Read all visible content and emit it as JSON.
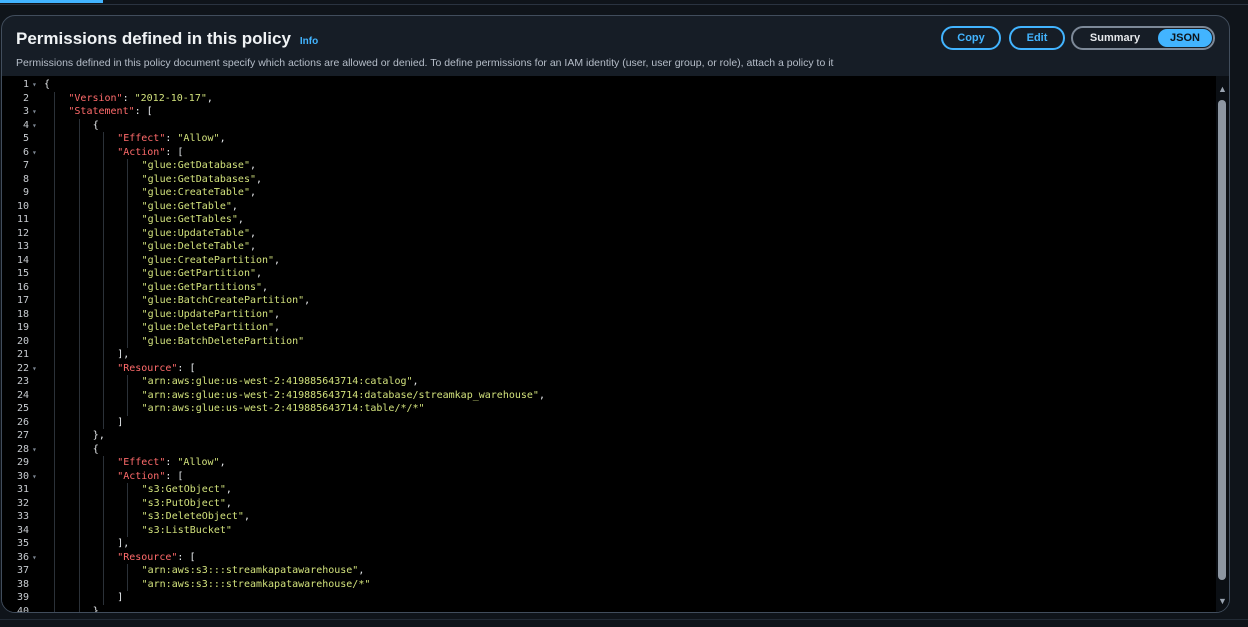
{
  "panel": {
    "title": "Permissions defined in this policy",
    "info_label": "Info",
    "description": "Permissions defined in this policy document specify which actions are allowed or denied. To define permissions for an IAM identity (user, user group, or role), attach a policy to it",
    "copy_label": "Copy",
    "edit_label": "Edit",
    "view_toggle": {
      "summary_label": "Summary",
      "json_label": "JSON",
      "selected": "JSON"
    }
  },
  "colors": {
    "accent": "#42b4ff",
    "json_key": "#ff6b6b",
    "json_string": "#d2e27c"
  },
  "editor": {
    "lines": [
      {
        "n": "1",
        "fold": true,
        "indent": 0,
        "tokens": [
          [
            "p",
            "{"
          ]
        ]
      },
      {
        "n": "2",
        "fold": false,
        "indent": 1,
        "tokens": [
          [
            "k",
            "\"Version\""
          ],
          [
            "p",
            ": "
          ],
          [
            "s",
            "\"2012-10-17\""
          ],
          [
            "p",
            ","
          ]
        ]
      },
      {
        "n": "3",
        "fold": true,
        "indent": 1,
        "tokens": [
          [
            "k",
            "\"Statement\""
          ],
          [
            "p",
            ": ["
          ]
        ]
      },
      {
        "n": "4",
        "fold": true,
        "indent": 2,
        "tokens": [
          [
            "p",
            "{"
          ]
        ]
      },
      {
        "n": "5",
        "fold": false,
        "indent": 3,
        "tokens": [
          [
            "k",
            "\"Effect\""
          ],
          [
            "p",
            ": "
          ],
          [
            "s",
            "\"Allow\""
          ],
          [
            "p",
            ","
          ]
        ]
      },
      {
        "n": "6",
        "fold": true,
        "indent": 3,
        "tokens": [
          [
            "k",
            "\"Action\""
          ],
          [
            "p",
            ": ["
          ]
        ]
      },
      {
        "n": "7",
        "fold": false,
        "indent": 4,
        "tokens": [
          [
            "s",
            "\"glue:GetDatabase\""
          ],
          [
            "p",
            ","
          ]
        ]
      },
      {
        "n": "8",
        "fold": false,
        "indent": 4,
        "tokens": [
          [
            "s",
            "\"glue:GetDatabases\""
          ],
          [
            "p",
            ","
          ]
        ]
      },
      {
        "n": "9",
        "fold": false,
        "indent": 4,
        "tokens": [
          [
            "s",
            "\"glue:CreateTable\""
          ],
          [
            "p",
            ","
          ]
        ]
      },
      {
        "n": "10",
        "fold": false,
        "indent": 4,
        "tokens": [
          [
            "s",
            "\"glue:GetTable\""
          ],
          [
            "p",
            ","
          ]
        ]
      },
      {
        "n": "11",
        "fold": false,
        "indent": 4,
        "tokens": [
          [
            "s",
            "\"glue:GetTables\""
          ],
          [
            "p",
            ","
          ]
        ]
      },
      {
        "n": "12",
        "fold": false,
        "indent": 4,
        "tokens": [
          [
            "s",
            "\"glue:UpdateTable\""
          ],
          [
            "p",
            ","
          ]
        ]
      },
      {
        "n": "13",
        "fold": false,
        "indent": 4,
        "tokens": [
          [
            "s",
            "\"glue:DeleteTable\""
          ],
          [
            "p",
            ","
          ]
        ]
      },
      {
        "n": "14",
        "fold": false,
        "indent": 4,
        "tokens": [
          [
            "s",
            "\"glue:CreatePartition\""
          ],
          [
            "p",
            ","
          ]
        ]
      },
      {
        "n": "15",
        "fold": false,
        "indent": 4,
        "tokens": [
          [
            "s",
            "\"glue:GetPartition\""
          ],
          [
            "p",
            ","
          ]
        ]
      },
      {
        "n": "16",
        "fold": false,
        "indent": 4,
        "tokens": [
          [
            "s",
            "\"glue:GetPartitions\""
          ],
          [
            "p",
            ","
          ]
        ]
      },
      {
        "n": "17",
        "fold": false,
        "indent": 4,
        "tokens": [
          [
            "s",
            "\"glue:BatchCreatePartition\""
          ],
          [
            "p",
            ","
          ]
        ]
      },
      {
        "n": "18",
        "fold": false,
        "indent": 4,
        "tokens": [
          [
            "s",
            "\"glue:UpdatePartition\""
          ],
          [
            "p",
            ","
          ]
        ]
      },
      {
        "n": "19",
        "fold": false,
        "indent": 4,
        "tokens": [
          [
            "s",
            "\"glue:DeletePartition\""
          ],
          [
            "p",
            ","
          ]
        ]
      },
      {
        "n": "20",
        "fold": false,
        "indent": 4,
        "tokens": [
          [
            "s",
            "\"glue:BatchDeletePartition\""
          ]
        ]
      },
      {
        "n": "21",
        "fold": false,
        "indent": 3,
        "tokens": [
          [
            "p",
            "],"
          ]
        ]
      },
      {
        "n": "22",
        "fold": true,
        "indent": 3,
        "tokens": [
          [
            "k",
            "\"Resource\""
          ],
          [
            "p",
            ": ["
          ]
        ]
      },
      {
        "n": "23",
        "fold": false,
        "indent": 4,
        "tokens": [
          [
            "s",
            "\"arn:aws:glue:us-west-2:419885643714:catalog\""
          ],
          [
            "p",
            ","
          ]
        ]
      },
      {
        "n": "24",
        "fold": false,
        "indent": 4,
        "tokens": [
          [
            "s",
            "\"arn:aws:glue:us-west-2:419885643714:database/streamkap_warehouse\""
          ],
          [
            "p",
            ","
          ]
        ]
      },
      {
        "n": "25",
        "fold": false,
        "indent": 4,
        "tokens": [
          [
            "s",
            "\"arn:aws:glue:us-west-2:419885643714:table/*/*\""
          ]
        ]
      },
      {
        "n": "26",
        "fold": false,
        "indent": 3,
        "tokens": [
          [
            "p",
            "]"
          ]
        ]
      },
      {
        "n": "27",
        "fold": false,
        "indent": 2,
        "tokens": [
          [
            "p",
            "},"
          ]
        ]
      },
      {
        "n": "28",
        "fold": true,
        "indent": 2,
        "tokens": [
          [
            "p",
            "{"
          ]
        ]
      },
      {
        "n": "29",
        "fold": false,
        "indent": 3,
        "tokens": [
          [
            "k",
            "\"Effect\""
          ],
          [
            "p",
            ": "
          ],
          [
            "s",
            "\"Allow\""
          ],
          [
            "p",
            ","
          ]
        ]
      },
      {
        "n": "30",
        "fold": true,
        "indent": 3,
        "tokens": [
          [
            "k",
            "\"Action\""
          ],
          [
            "p",
            ": ["
          ]
        ]
      },
      {
        "n": "31",
        "fold": false,
        "indent": 4,
        "tokens": [
          [
            "s",
            "\"s3:GetObject\""
          ],
          [
            "p",
            ","
          ]
        ]
      },
      {
        "n": "32",
        "fold": false,
        "indent": 4,
        "tokens": [
          [
            "s",
            "\"s3:PutObject\""
          ],
          [
            "p",
            ","
          ]
        ]
      },
      {
        "n": "33",
        "fold": false,
        "indent": 4,
        "tokens": [
          [
            "s",
            "\"s3:DeleteObject\""
          ],
          [
            "p",
            ","
          ]
        ]
      },
      {
        "n": "34",
        "fold": false,
        "indent": 4,
        "tokens": [
          [
            "s",
            "\"s3:ListBucket\""
          ]
        ]
      },
      {
        "n": "35",
        "fold": false,
        "indent": 3,
        "tokens": [
          [
            "p",
            "],"
          ]
        ]
      },
      {
        "n": "36",
        "fold": true,
        "indent": 3,
        "tokens": [
          [
            "k",
            "\"Resource\""
          ],
          [
            "p",
            ": ["
          ]
        ]
      },
      {
        "n": "37",
        "fold": false,
        "indent": 4,
        "tokens": [
          [
            "s",
            "\"arn:aws:s3:::streamkapatawarehouse\""
          ],
          [
            "p",
            ","
          ]
        ]
      },
      {
        "n": "38",
        "fold": false,
        "indent": 4,
        "tokens": [
          [
            "s",
            "\"arn:aws:s3:::streamkapatawarehouse/*\""
          ]
        ]
      },
      {
        "n": "39",
        "fold": false,
        "indent": 3,
        "tokens": [
          [
            "p",
            "]"
          ]
        ]
      },
      {
        "n": "40",
        "fold": false,
        "indent": 2,
        "tokens": [
          [
            "p",
            "}"
          ]
        ]
      }
    ]
  },
  "icons": {
    "fold": "fold-chevron-icon",
    "scroll_up": "scroll-up-arrow-icon",
    "scroll_down": "scroll-down-arrow-icon"
  }
}
